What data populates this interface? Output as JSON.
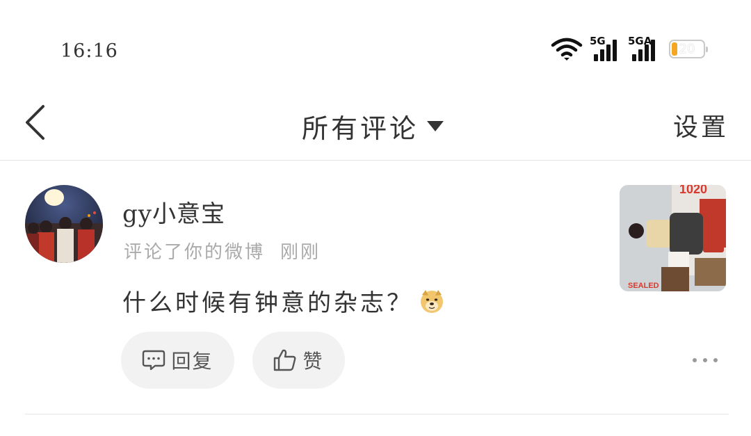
{
  "status_bar": {
    "time": "16:16",
    "signal_1_label": "5G",
    "signal_2_label": "5GA",
    "battery_level": "20",
    "battery_color": "#f5a623"
  },
  "nav": {
    "back_icon": "chevron-left-icon",
    "title": "所有评论",
    "title_icon": "caret-down-icon",
    "settings_label": "设置"
  },
  "comments": [
    {
      "username": "gy小意宝",
      "action": "评论了你的微博",
      "time": "刚刚",
      "text": "什么时候有钟意的杂志？",
      "emoji": "doge-emoji",
      "reply_label": "回复",
      "like_label": "赞",
      "more_icon": "more-horizontal-icon"
    }
  ]
}
